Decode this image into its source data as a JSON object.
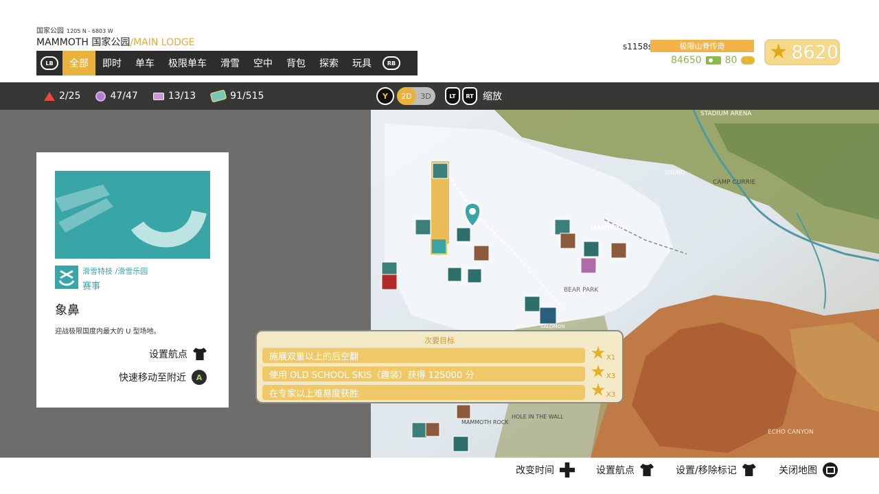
{
  "header": {
    "location_small": "国家公园",
    "coords": "1205 N - 6803 W",
    "location_main": "MAMMOTH 国家公园",
    "location_sub": "/MAIN LODGE"
  },
  "tabs": {
    "lb": "LB",
    "rb": "RB",
    "items": [
      "全部",
      "即时",
      "单车",
      "极限单车",
      "滑雪",
      "空中",
      "背包",
      "探索",
      "玩具"
    ],
    "active_index": 0
  },
  "player": {
    "id": "s1158s",
    "title": "极限山脊传奇",
    "credits": "84650",
    "wheel_count": "80",
    "accolades": "8620"
  },
  "stats": [
    {
      "icon": "triangle-icon",
      "value": "2/25"
    },
    {
      "icon": "circle-icon",
      "value": "47/47"
    },
    {
      "icon": "card-icon",
      "value": "13/13"
    },
    {
      "icon": "board-icon",
      "value": "91/515"
    }
  ],
  "view_controls": {
    "y_button": "Y",
    "mode_2d": "2D",
    "mode_3d": "3D",
    "active_mode": "2D",
    "lt": "LT",
    "rt": "RT",
    "zoom_label": "缩放"
  },
  "event_card": {
    "category": "滑雪特技 /滑雪乐园",
    "type": "赛事",
    "name": "象鼻",
    "description": "迎战极限国度内最大的 U 型场地。",
    "set_waypoint": "设置航点",
    "fast_travel": "快速移动至附近",
    "a_button": "A"
  },
  "objectives": {
    "header": "次要目标",
    "items": [
      {
        "text": "施展双重以上的后空翻",
        "multiplier": "X1"
      },
      {
        "text": "使用 OLD SCHOOL SKIS（趣装）获得 125000 分",
        "multiplier": "X3"
      },
      {
        "text": "在专家以上难易度获胜",
        "multiplier": "X3"
      }
    ]
  },
  "map_labels": {
    "camp": "CAMP CURRIE",
    "stadium": "STADIUM ARENA",
    "bear_park": "BEAR PARK",
    "mammoth_rock": "MAMMOTH ROCK",
    "hole_in_wall": "HOLE IN THE WALL",
    "echo_canyon": "ECHO CANYON",
    "sound": "SOUND",
    "salomon": "SALOMON"
  },
  "footer": {
    "change_time": "改变时间",
    "set_waypoint": "设置航点",
    "set_remove_marker": "设置/移除标记",
    "close_map": "关闭地图"
  },
  "colors": {
    "accent_gold": "#e8b23c",
    "teal": "#3aa5a7",
    "credits_green": "#8ab84a",
    "tab_bar": "#2d2d2d"
  }
}
